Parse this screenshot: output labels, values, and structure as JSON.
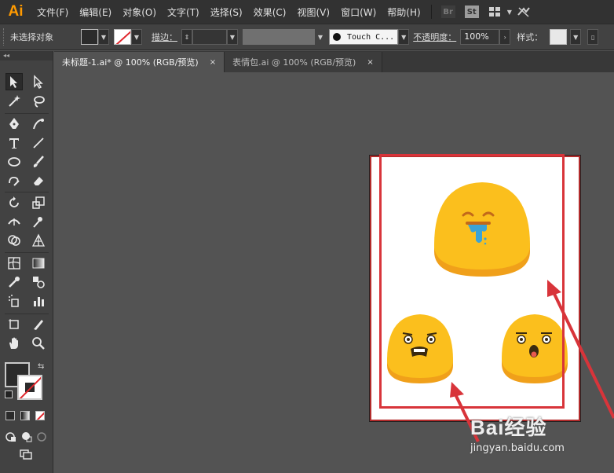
{
  "app": {
    "logo": "Ai"
  },
  "menu": {
    "items": [
      "文件(F)",
      "编辑(E)",
      "对象(O)",
      "文字(T)",
      "选择(S)",
      "效果(C)",
      "视图(V)",
      "窗口(W)",
      "帮助(H)"
    ],
    "icons": [
      "br-icon",
      "st-icon",
      "workspace-grid-icon",
      "sync-icon"
    ],
    "br_label": "Br",
    "st_label": "St"
  },
  "control": {
    "selection_label": "未选择对象",
    "stroke_label": "描边：",
    "brush_label": "Touch C...",
    "opacity_label": "不透明度：",
    "opacity_value": "100%",
    "style_label": "样式："
  },
  "tabs": [
    {
      "label": "未标题-1.ai* @ 100% (RGB/预览)",
      "close": "×",
      "active": true
    },
    {
      "label": "表情包.ai @ 100% (RGB/预览)",
      "close": "×",
      "active": false
    }
  ],
  "toolbox": {
    "collapse": "◂◂"
  },
  "watermark": {
    "logo": "Bai经验",
    "url": "jingyan.baidu.com"
  },
  "colors": {
    "emoji_yellow": "#fbbf1d",
    "emoji_shadow": "#f0a01a",
    "highlight_red": "#d8343a",
    "drool_blue": "#3aa3d6",
    "ai_orange": "#ff9a00"
  }
}
